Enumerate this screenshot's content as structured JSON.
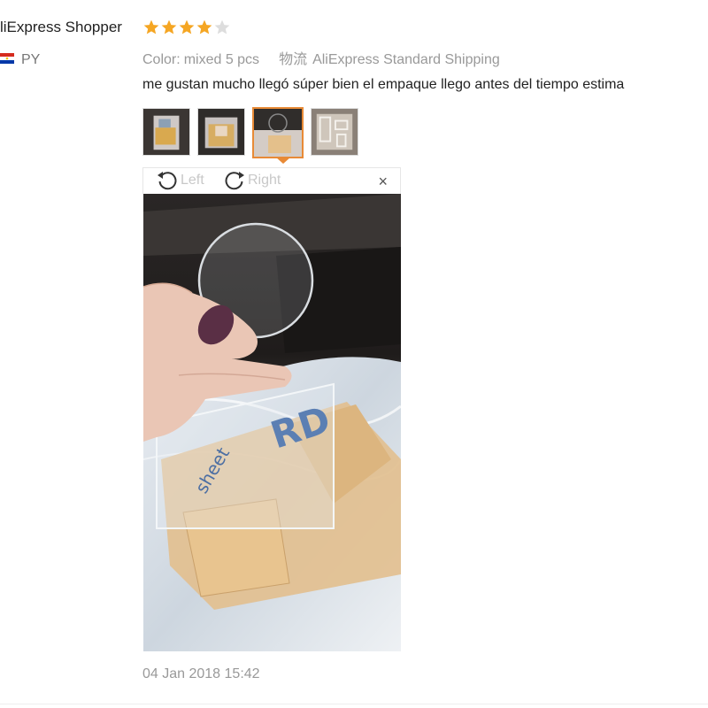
{
  "review": {
    "shopper_name": "liExpress Shopper",
    "rating": 4,
    "max_rating": 5,
    "country_code": "PY",
    "color_label": "Color:",
    "color_value": "mixed 5 pcs",
    "shipping_label": "物流",
    "shipping_value": "AliExpress Standard Shipping",
    "text": "me gustan mucho llegó súper bien el empaque llego antes del tiempo estima",
    "date": "04 Jan 2018 15:42"
  },
  "viewer": {
    "rotate_left_label": "Left",
    "rotate_right_label": "Right",
    "close_glyph": "×",
    "active_thumbnail_index": 2,
    "thumbnail_count": 4
  },
  "icons": {
    "star_filled": "star-icon",
    "star_empty": "star-empty-icon",
    "flag": "paraguay-flag-icon",
    "rotate_left": "rotate-left-icon",
    "rotate_right": "rotate-right-icon",
    "close": "close-icon"
  },
  "colors": {
    "star": "#f5a623",
    "star_empty": "#dddddd",
    "active_border": "#e88a36",
    "muted_text": "#999999"
  }
}
